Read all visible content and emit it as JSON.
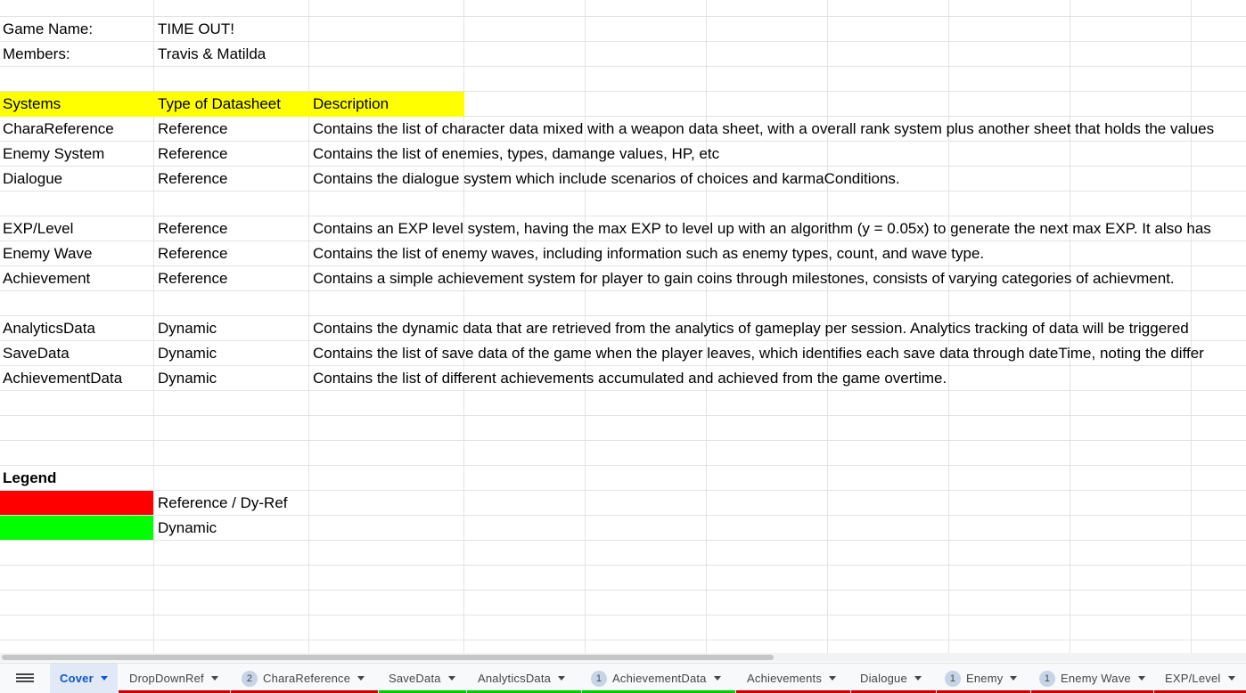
{
  "sheet": {
    "game_name_label": "Game Name:",
    "game_name_value": "TIME OUT!",
    "members_label": "Members:",
    "members_value": "Travis & Matilda",
    "headers": {
      "systems": "Systems",
      "type": "Type of Datasheet",
      "description": "Description"
    },
    "rows": [
      {
        "system": "CharaReference",
        "type": "Reference",
        "description": "Contains the list of character data mixed with a weapon data sheet, with a overall rank system plus another sheet that holds the values"
      },
      {
        "system": "Enemy System",
        "type": "Reference",
        "description": "Contains the list of enemies, types, damange values, HP, etc"
      },
      {
        "system": "Dialogue",
        "type": "Reference",
        "description": "Contains the dialogue system which include scenarios of choices and karmaConditions."
      },
      {
        "system": "EXP/Level",
        "type": "Reference",
        "description": "Contains an EXP level system, having the max EXP to level up with an algorithm (y = 0.05x) to generate the next max EXP. It also has"
      },
      {
        "system": "Enemy Wave",
        "type": "Reference",
        "description": "Contains the list of enemy waves, including information such as enemy types, count, and wave type."
      },
      {
        "system": "Achievement",
        "type": "Reference",
        "description": "Contains a simple achievement system for player to gain coins through milestones, consists of varying categories of achievment."
      },
      {
        "system": "AnalyticsData",
        "type": "Dynamic",
        "description": "Contains the dynamic data that are retrieved from the analytics of gameplay per session. Analytics tracking of data will be triggered"
      },
      {
        "system": "SaveData",
        "type": "Dynamic",
        "description": "Contains the list of save data of the game when the player leaves, which identifies each save data through dateTime, noting the differ"
      },
      {
        "system": "AchievementData",
        "type": "Dynamic",
        "description": "Contains the list of different achievements accumulated and achieved from the game overtime."
      }
    ],
    "legend": {
      "title": "Legend",
      "reference_label": "Reference / Dy-Ref",
      "reference_color": "#ff0000",
      "dynamic_label": "Dynamic",
      "dynamic_color": "#00ff00"
    },
    "header_fill_color": "#ffff00"
  },
  "tabs": [
    {
      "label": "Cover",
      "badge": "",
      "active": true,
      "color": ""
    },
    {
      "label": "DropDownRef",
      "badge": "",
      "active": false,
      "color": "#cc0000"
    },
    {
      "label": "CharaReference",
      "badge": "2",
      "active": false,
      "color": "#cc0000"
    },
    {
      "label": "SaveData",
      "badge": "",
      "active": false,
      "color": "#00cc00"
    },
    {
      "label": "AnalyticsData",
      "badge": "",
      "active": false,
      "color": "#00cc00"
    },
    {
      "label": "AchievementData",
      "badge": "1",
      "active": false,
      "color": "#00cc00"
    },
    {
      "label": "Achievements",
      "badge": "",
      "active": false,
      "color": "#cc0000"
    },
    {
      "label": "Dialogue",
      "badge": "",
      "active": false,
      "color": "#cc0000"
    },
    {
      "label": "Enemy",
      "badge": "1",
      "active": false,
      "color": "#cc0000"
    },
    {
      "label": "Enemy Wave",
      "badge": "1",
      "active": false,
      "color": "#cc0000"
    },
    {
      "label": "EXP/Level",
      "badge": "",
      "active": false,
      "color": "#cc0000"
    }
  ]
}
